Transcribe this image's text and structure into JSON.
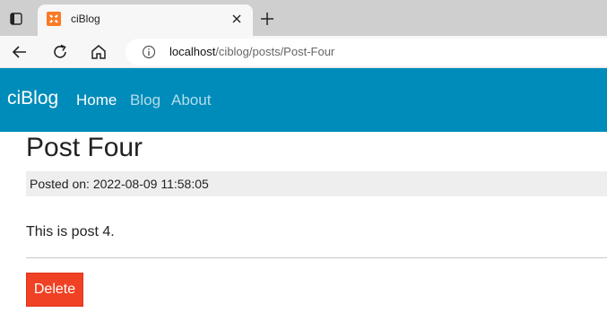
{
  "browser": {
    "tab": {
      "title": "ciBlog",
      "favicon": "xampp-icon",
      "favicon_color": "#fb7a24"
    },
    "toolbar": {
      "back_icon": "back-arrow-icon",
      "reload_icon": "reload-icon",
      "home_icon": "home-icon"
    },
    "address": {
      "host": "localhost",
      "path": "/ciblog/posts/Post-Four"
    }
  },
  "navbar": {
    "brand": "ciBlog",
    "links": [
      {
        "label": "Home",
        "active": true
      },
      {
        "label": "Blog",
        "active": false
      },
      {
        "label": "About",
        "active": false
      }
    ],
    "color": "#008cba"
  },
  "post": {
    "title": "Post Four",
    "meta": "Posted on: 2022-08-09 11:58:05",
    "body": "This is post 4.",
    "delete_label": "Delete",
    "delete_color": "#f04124"
  }
}
